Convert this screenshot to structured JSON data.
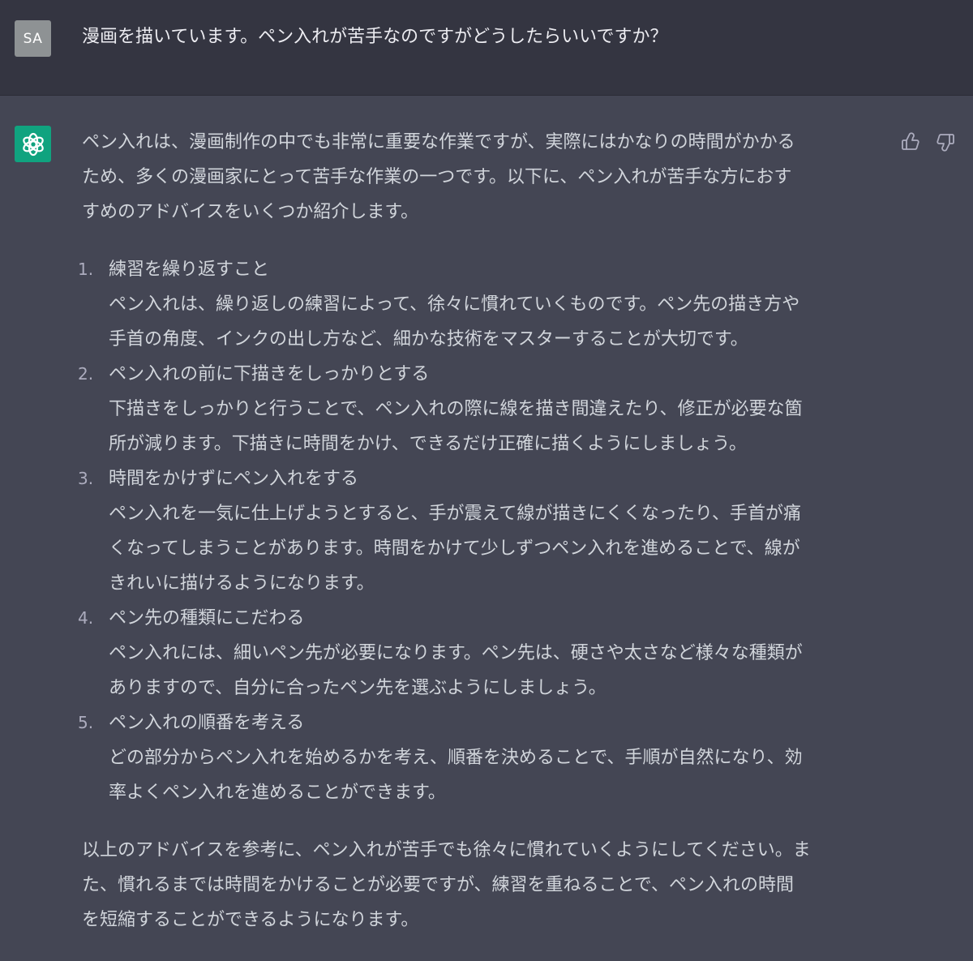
{
  "user_message": {
    "avatar_initials": "SA",
    "text": "漫画を描いています。ペン入れが苦手なのですがどうしたらいいですか？"
  },
  "assistant_message": {
    "logo_icon": "openai-logo-icon",
    "intro": "ペン入れは、漫画制作の中でも非常に重要な作業ですが、実際にはかなりの時間がかかる\nため、多くの漫画家にとって苦手な作業の一つです。以下に、ペン入れが苦手な方におす\nすめのアドバイスをいくつか紹介します。",
    "items": [
      {
        "number": "1.",
        "title": "練習を繰り返すこと",
        "body": "ペン入れは、繰り返しの練習によって、徐々に慣れていくものです。ペン先の描き方や\n手首の角度、インクの出し方など、細かな技術をマスターすることが大切です。"
      },
      {
        "number": "2.",
        "title": "ペン入れの前に下描きをしっかりとする",
        "body": "下描きをしっかりと行うことで、ペン入れの際に線を描き間違えたり、修正が必要な箇\n所が減ります。下描きに時間をかけ、できるだけ正確に描くようにしましょう。"
      },
      {
        "number": "3.",
        "title": "時間をかけずにペン入れをする",
        "body": "ペン入れを一気に仕上げようとすると、手が震えて線が描きにくくなったり、手首が痛\nくなってしまうことがあります。時間をかけて少しずつペン入れを進めることで、線が\nきれいに描けるようになります。"
      },
      {
        "number": "4.",
        "title": "ペン先の種類にこだわる",
        "body": "ペン入れには、細いペン先が必要になります。ペン先は、硬さや太さなど様々な種類が\nありますので、自分に合ったペン先を選ぶようにしましょう。"
      },
      {
        "number": "5.",
        "title": "ペン入れの順番を考える",
        "body": "どの部分からペン入れを始めるかを考え、順番を決めることで、手順が自然になり、効\n率よくペン入れを進めることができます。"
      }
    ],
    "outro": "以上のアドバイスを参考に、ペン入れが苦手でも徐々に慣れていくようにしてください。ま\nた、慣れるまでは時間をかけることが必要ですが、練習を重ねることで、ペン入れの時間\nを短縮することができるようになります。"
  },
  "feedback": {
    "up_icon": "thumbs-up-icon",
    "down_icon": "thumbs-down-icon"
  },
  "colors": {
    "user_bg": "#343541",
    "assistant_bg": "#444654",
    "logo_green": "#10a37f",
    "avatar_gray": "#8e9294",
    "text": "#d1d5db"
  }
}
